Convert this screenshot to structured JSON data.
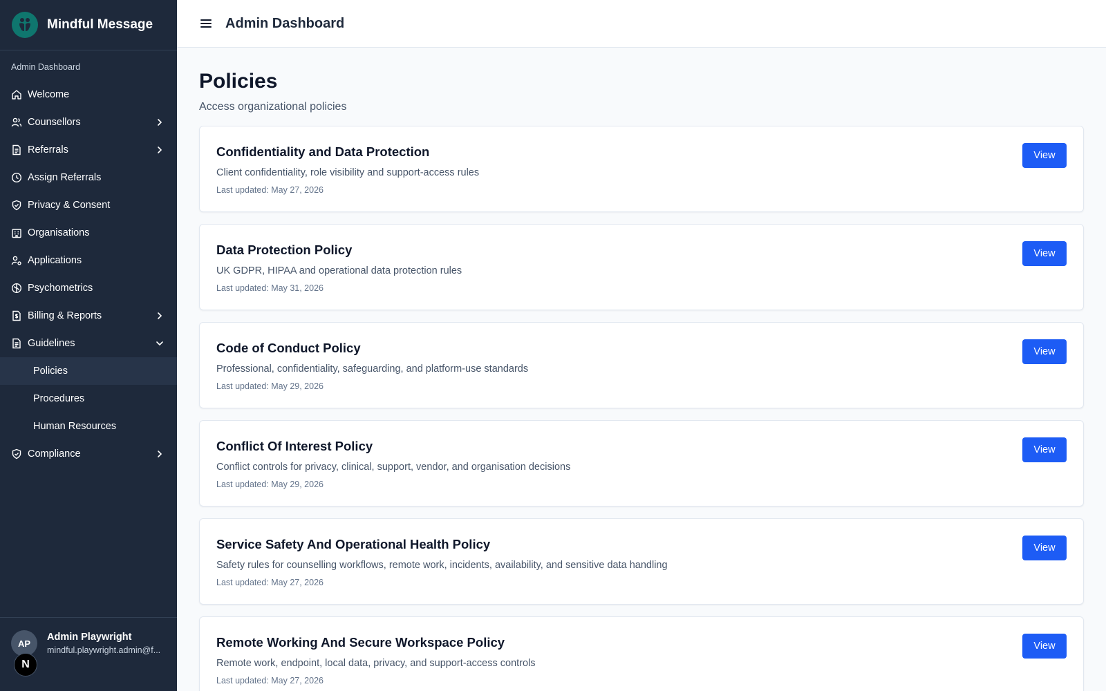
{
  "brand": {
    "name": "Mindful Message"
  },
  "sidebar": {
    "section_label": "Admin Dashboard",
    "items": [
      {
        "label": "Welcome",
        "icon": "home-icon",
        "chevron": "none"
      },
      {
        "label": "Counsellors",
        "icon": "users-icon",
        "chevron": "right"
      },
      {
        "label": "Referrals",
        "icon": "document-icon",
        "chevron": "right"
      },
      {
        "label": "Assign Referrals",
        "icon": "clock-icon",
        "chevron": "none"
      },
      {
        "label": "Privacy & Consent",
        "icon": "shield-icon",
        "chevron": "none"
      },
      {
        "label": "Organisations",
        "icon": "building-icon",
        "chevron": "none"
      },
      {
        "label": "Applications",
        "icon": "user-cog-icon",
        "chevron": "none"
      },
      {
        "label": "Psychometrics",
        "icon": "brain-icon",
        "chevron": "none"
      },
      {
        "label": "Billing & Reports",
        "icon": "dollar-document-icon",
        "chevron": "right"
      },
      {
        "label": "Guidelines",
        "icon": "document-icon",
        "chevron": "down"
      }
    ],
    "guidelines_subitems": [
      {
        "label": "Policies",
        "active": true
      },
      {
        "label": "Procedures",
        "active": false
      },
      {
        "label": "Human Resources",
        "active": false
      }
    ],
    "compliance": {
      "label": "Compliance",
      "icon": "shield-icon",
      "chevron": "right"
    }
  },
  "user": {
    "initials": "AP",
    "name": "Admin Playwright",
    "email": "mindful.playwright.admin@f...",
    "badge": "N"
  },
  "header": {
    "title": "Admin Dashboard"
  },
  "page": {
    "title": "Policies",
    "subtitle": "Access organizational policies"
  },
  "policies": [
    {
      "title": "Confidentiality and Data Protection",
      "description": "Client confidentiality, role visibility and support-access rules",
      "updated": "Last updated: May 27, 2026",
      "button": "View"
    },
    {
      "title": "Data Protection Policy",
      "description": "UK GDPR, HIPAA and operational data protection rules",
      "updated": "Last updated: May 31, 2026",
      "button": "View"
    },
    {
      "title": "Code of Conduct Policy",
      "description": "Professional, confidentiality, safeguarding, and platform-use standards",
      "updated": "Last updated: May 29, 2026",
      "button": "View"
    },
    {
      "title": "Conflict Of Interest Policy",
      "description": "Conflict controls for privacy, clinical, support, vendor, and organisation decisions",
      "updated": "Last updated: May 29, 2026",
      "button": "View"
    },
    {
      "title": "Service Safety And Operational Health Policy",
      "description": "Safety rules for counselling workflows, remote work, incidents, availability, and sensitive data handling",
      "updated": "Last updated: May 27, 2026",
      "button": "View"
    },
    {
      "title": "Remote Working And Secure Workspace Policy",
      "description": "Remote work, endpoint, local data, privacy, and support-access controls",
      "updated": "Last updated: May 27, 2026",
      "button": "View"
    }
  ],
  "colors": {
    "sidebar_bg": "#1e293b",
    "accent": "#1d5cf5",
    "logo": "#0f766e"
  }
}
